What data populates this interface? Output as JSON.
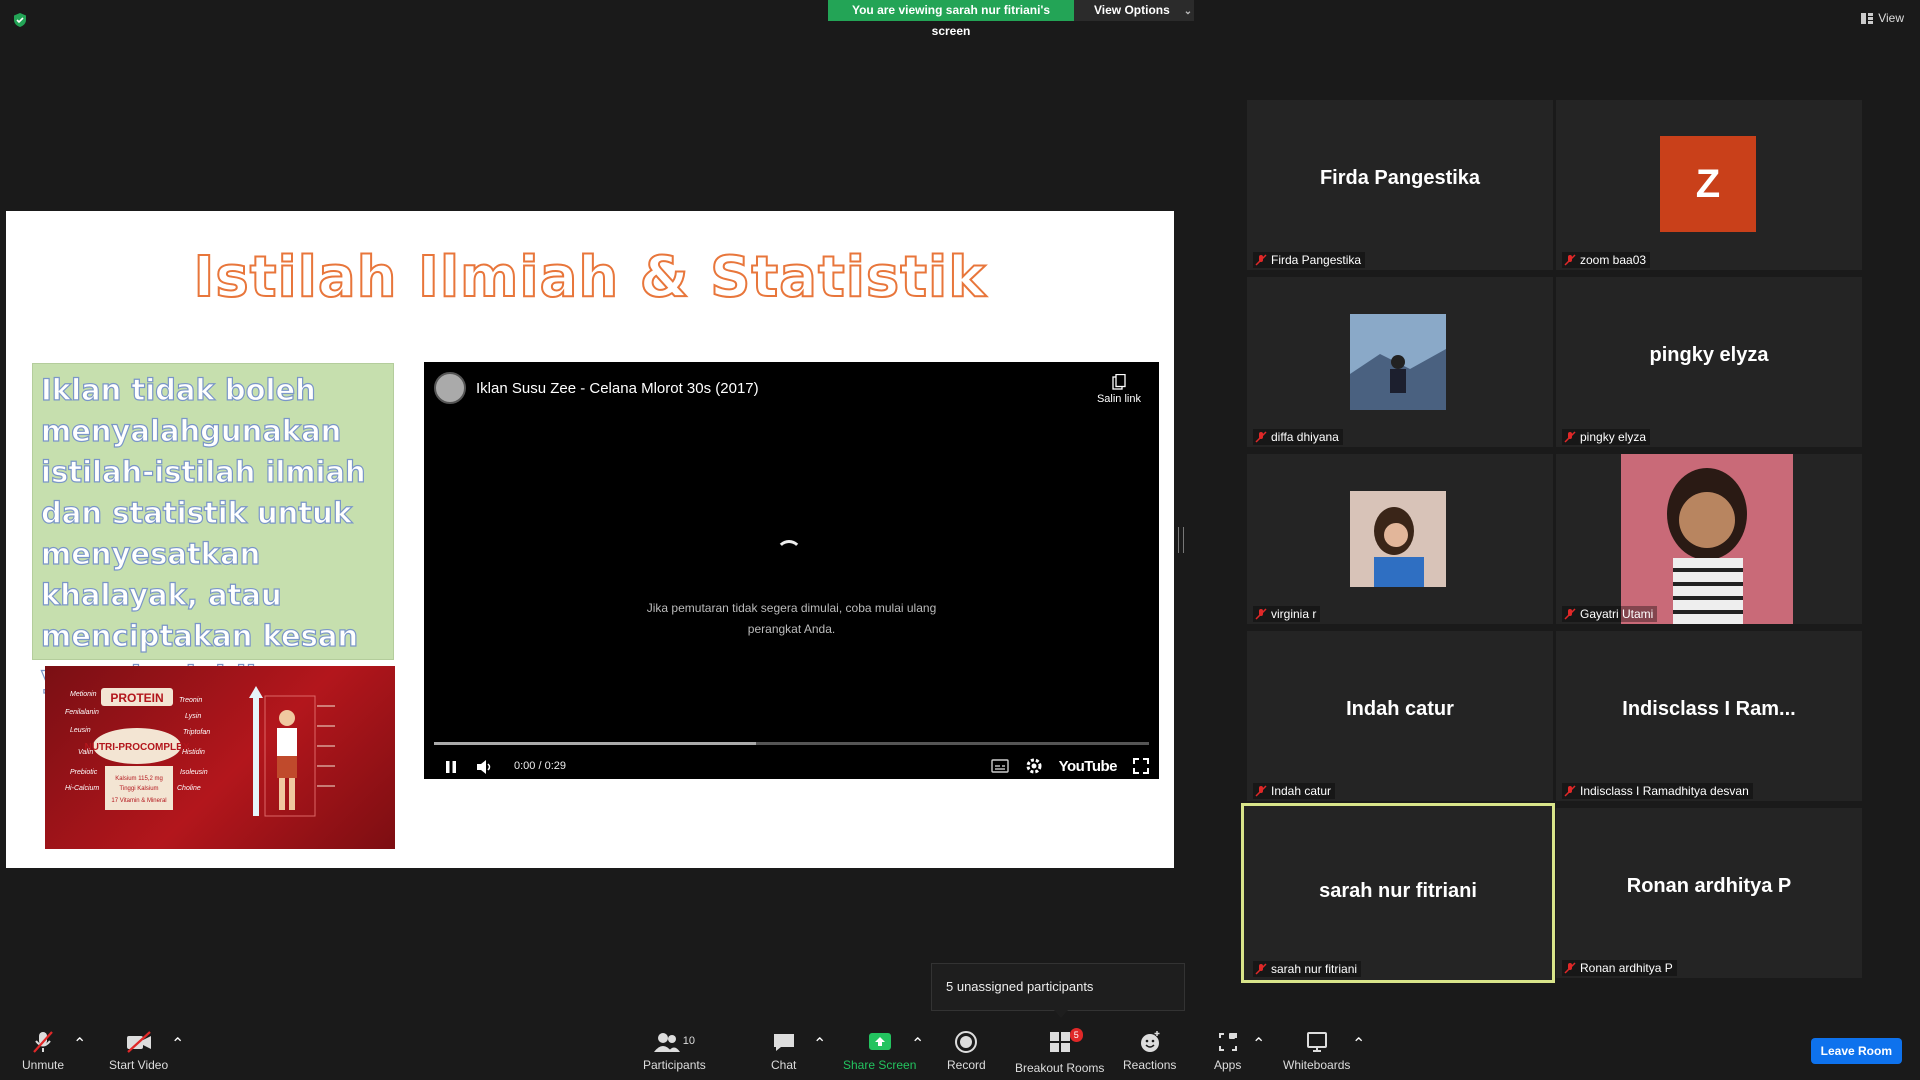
{
  "banner": {
    "message": "You are viewing sarah nur fitriani's screen",
    "view_options": "View Options"
  },
  "view_label": "View",
  "slide": {
    "title": "Istilah Ilmiah & Statistik",
    "body": "Iklan tidak boleh menyalahgunakan istilah-istilah  ilmiah dan statistik untuk menyesatkan khalayak, atau menciptakan kesan yang berlebihan.",
    "ad_words": [
      "PROTEIN",
      "NUTRI-PROCOMPLEX",
      "Metionin",
      "Fenilalanin",
      "Leusin",
      "Valin",
      "Prebiotic",
      "Hi-Calcium",
      "Treonin",
      "Lysin",
      "Triptofan",
      "Histidin",
      "Isoleusin",
      "Choline",
      "Kalsium 115,2 mg",
      "Tinggi Kalsium",
      "17 Vitamin & Mineral"
    ]
  },
  "video": {
    "title": "Iklan Susu Zee - Celana Mlorot 30s (2017)",
    "copy_link": "Salin link",
    "message": "Jika pemutaran tidak segera dimulai, coba mulai ulang perangkat Anda.",
    "time": "0:00 / 0:29",
    "logo": "YouTube",
    "buffered": 0.45
  },
  "participants": [
    {
      "display": "Firda Pangestika",
      "label": "Firda Pangestika",
      "type": "name"
    },
    {
      "display": "Z",
      "label": "zoom baa03",
      "type": "avatar"
    },
    {
      "display": "",
      "label": "diffa dhiyana",
      "type": "photo"
    },
    {
      "display": "pingky elyza",
      "label": "pingky elyza",
      "type": "name"
    },
    {
      "display": "",
      "label": "virginia r",
      "type": "photo"
    },
    {
      "display": "",
      "label": "Gayatri Utami",
      "type": "photo"
    },
    {
      "display": "Indah catur",
      "label": "Indah catur",
      "type": "name"
    },
    {
      "display": "Indisclass I Ram...",
      "label": "Indisclass I Ramadhitya desvan",
      "type": "name"
    },
    {
      "display": "sarah nur fitriani",
      "label": "sarah nur fitriani",
      "type": "name",
      "active": true
    },
    {
      "display": "Ronan ardhitya P",
      "label": "Ronan ardhitya P",
      "type": "name"
    }
  ],
  "popup": {
    "unassigned": "5 unassigned participants"
  },
  "toolbar": {
    "unmute": "Unmute",
    "start_video": "Start Video",
    "participants": "Participants",
    "participants_count": "10",
    "chat": "Chat",
    "share_screen": "Share Screen",
    "record": "Record",
    "breakout_rooms": "Breakout Rooms",
    "breakout_badge": "5",
    "reactions": "Reactions",
    "apps": "Apps",
    "whiteboards": "Whiteboards",
    "leave_room": "Leave Room"
  },
  "colors": {
    "banner_green": "#23a456",
    "leave_blue": "#0e72ed",
    "active_border": "#d9e58a",
    "title_orange": "#e8763b",
    "avatar_orange": "#c9401a"
  }
}
